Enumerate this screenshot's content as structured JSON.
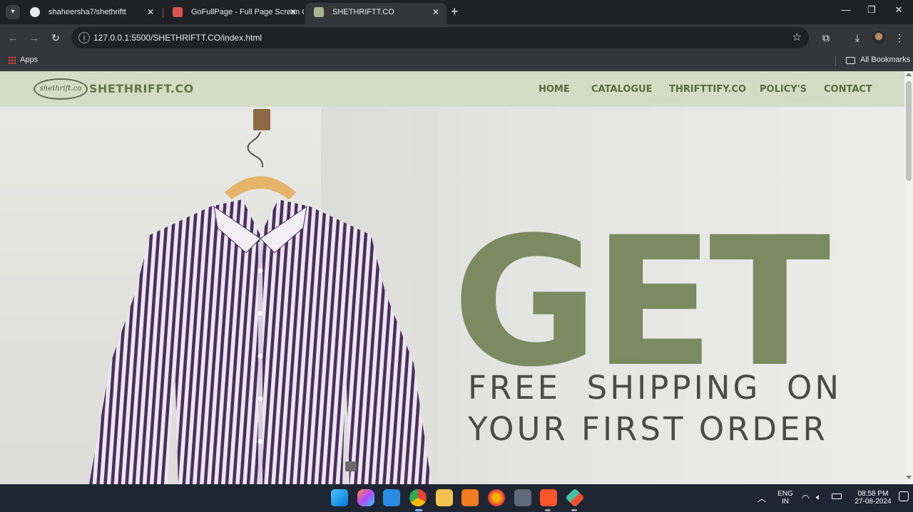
{
  "browser": {
    "tabs": [
      {
        "title": "shaheersha7/shethriftt",
        "icon": "github-icon"
      },
      {
        "title": "GoFullPage - Full Page Screen C",
        "icon": "gofullpage-icon"
      },
      {
        "title": "SHETHRIFTT.CO",
        "icon": "site-favicon"
      }
    ],
    "address": "127.0.0.1:5500/SHETHRIFTT.CO/index.html",
    "bookmarks": {
      "apps_label": "Apps",
      "all_bookmarks_label": "All Bookmarks"
    }
  },
  "site": {
    "logo_script": "shethrift.co",
    "logo_text": "SHETHRIFFT.CO",
    "nav": [
      "HOME",
      "CATALOGUE",
      "THRIFTTIFY.CO",
      "POLICY'S",
      "CONTACT"
    ],
    "hero": {
      "headline": "GET",
      "line1": "FREE  SHIPPING  ON",
      "line2": "YOUR FIRST ORDER"
    },
    "colors": {
      "nav_bg": "#d4dcc6",
      "accent": "#7c8a62",
      "text_dark": "#4b4b4b"
    }
  },
  "taskbar": {
    "apps": [
      "windows-start-icon",
      "copilot-icon",
      "vscode-icon",
      "chrome-icon",
      "file-explorer-icon",
      "xampp-icon",
      "firefox-icon",
      "calculator-icon",
      "brave-icon",
      "git-icon"
    ],
    "lang_top": "ENG",
    "lang_bottom": "IN",
    "time": "08:58 PM",
    "date": "27-08-2024"
  }
}
